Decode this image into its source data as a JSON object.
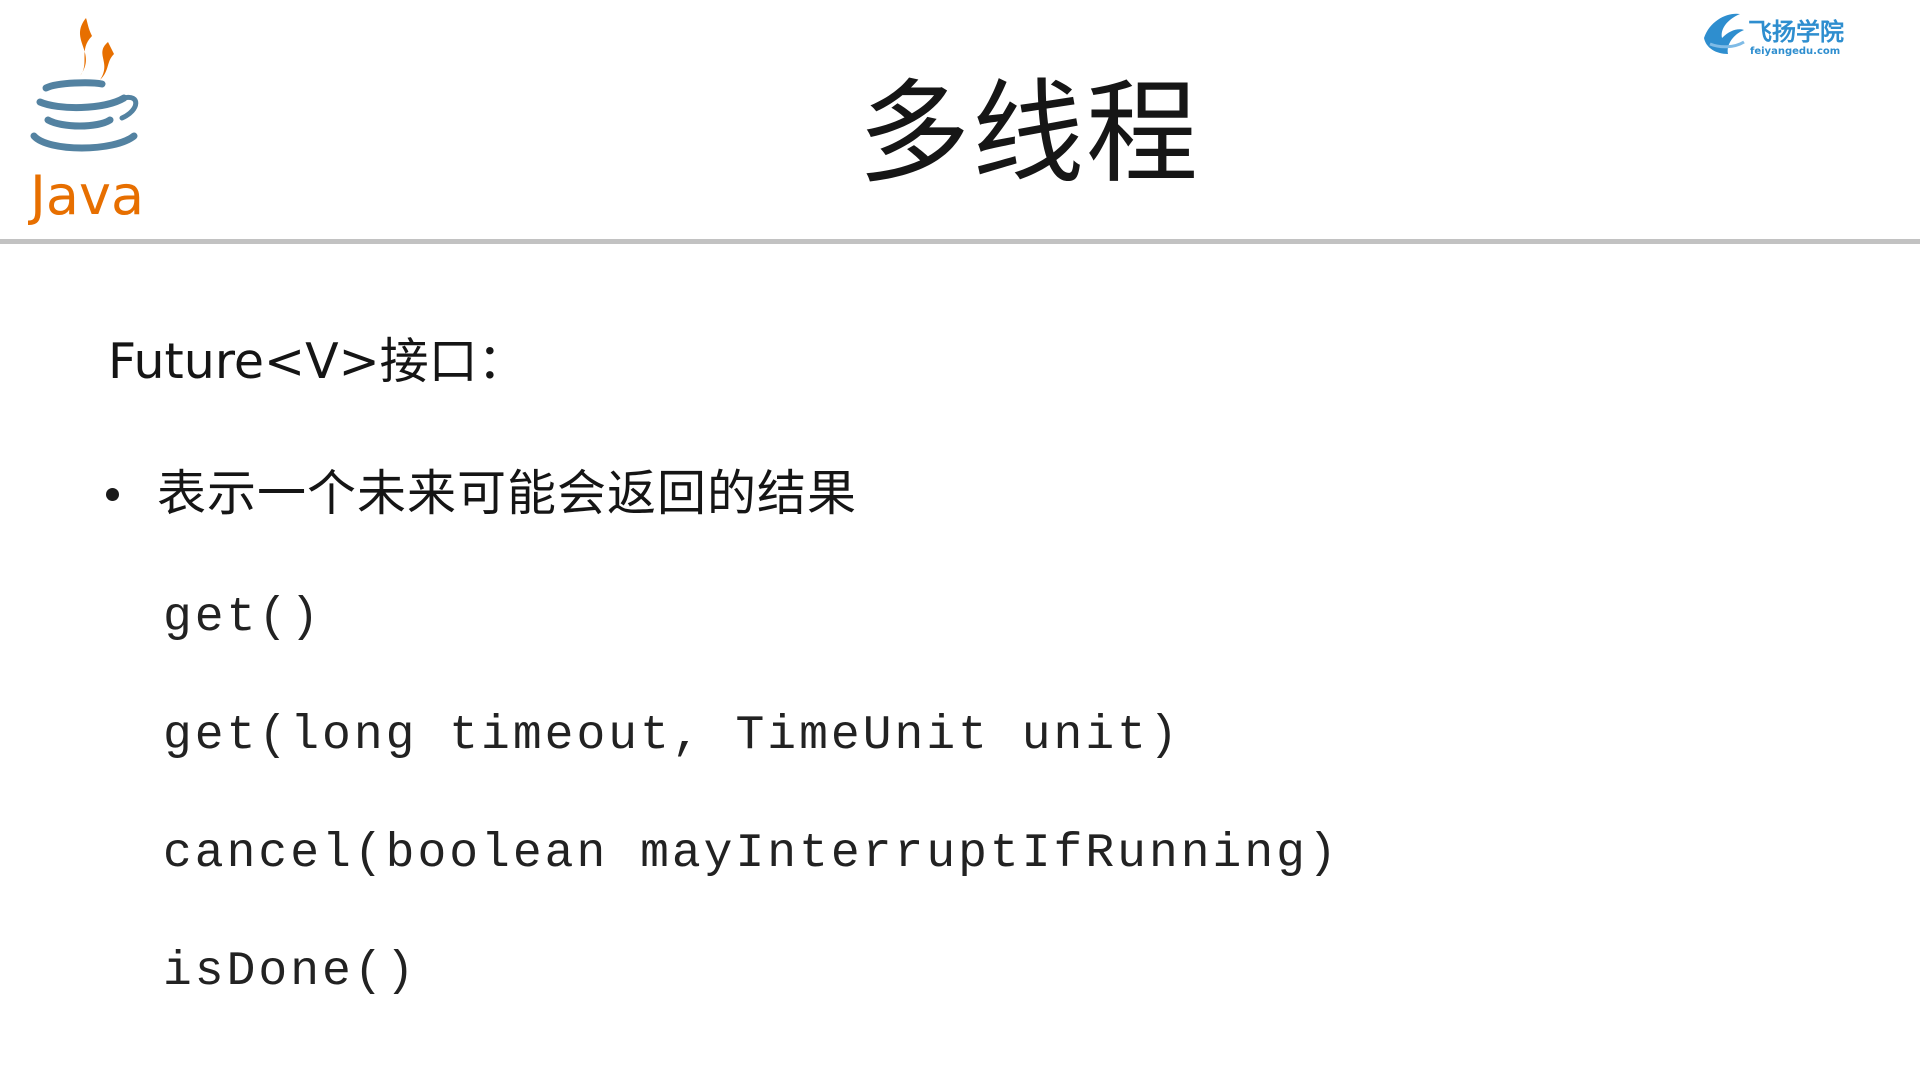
{
  "slide": {
    "title": "多线程",
    "intro": "Future<V>接口：",
    "bullet": "表示一个未来可能会返回的结果",
    "methods": [
      "get()",
      "get(long timeout, TimeUnit unit)",
      "cancel(boolean mayInterruptIfRunning)",
      "isDone()"
    ]
  },
  "logos": {
    "java": {
      "icon": "java-coffee-cup-icon",
      "wordmark": "Java"
    },
    "brand": {
      "icon": "feiyang-bird-icon",
      "name": "飞扬学院",
      "url": "feiyangedu.com"
    }
  },
  "colors": {
    "java_orange": "#e76f00",
    "java_blue": "#5382a1",
    "brand_blue": "#2e8ecf",
    "rule_gray": "#c2c2c2"
  }
}
